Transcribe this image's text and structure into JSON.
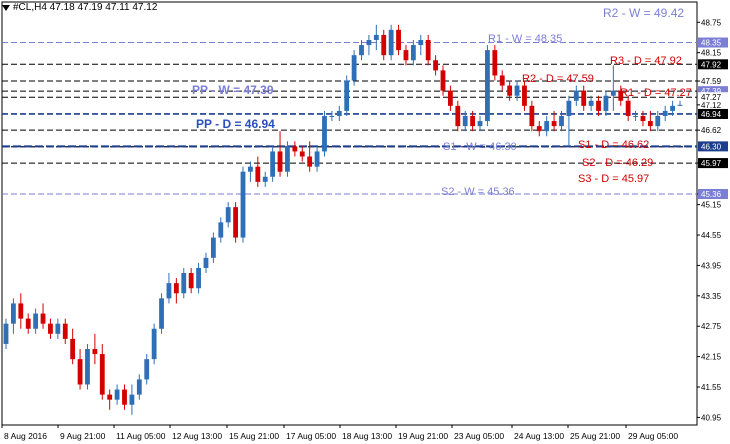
{
  "header": {
    "symbol_line": "#CL,H4  47.18 47.19 47.11 47.12"
  },
  "colors": {
    "bull": "#2f6fb5",
    "bear": "#d40000",
    "weekly_level": "#7b7fd4",
    "daily_pp": "#2b4fbf",
    "daily_r": "#d40000",
    "black_line": "#000000",
    "dark_dash": "#1c3c8c"
  },
  "chart_data": {
    "type": "candlestick",
    "ylim": [
      40.8,
      49.15
    ],
    "y_ticks": [
      "48.75",
      "48.15",
      "47.59",
      "47.12",
      "46.62",
      "45.97",
      "45.36",
      "45.15",
      "44.55",
      "43.95",
      "43.35",
      "42.75",
      "42.15",
      "41.55",
      "40.95"
    ],
    "x_ticks": [
      "8 Aug 2016",
      "9 Aug 21:00",
      "11 Aug 05:00",
      "12 Aug 13:00",
      "15 Aug 21:00",
      "17 Aug 05:00",
      "18 Aug 13:00",
      "19 Aug 21:00",
      "23 Aug 05:00",
      "24 Aug 13:00",
      "25 Aug 21:00",
      "29 Aug 05:00"
    ],
    "levels": [
      {
        "label": "R2 - W = 49.42",
        "value": 49.42,
        "kind": "weekly"
      },
      {
        "label": "R1 - W = 48.35",
        "value": 48.35,
        "kind": "weekly"
      },
      {
        "label": "R3 - D = 47.92",
        "value": 47.92,
        "kind": "daily_r"
      },
      {
        "label": "R2 - D = 47.59",
        "value": 47.59,
        "kind": "daily_r"
      },
      {
        "label": "PP - W = 47.39",
        "value": 47.39,
        "kind": "pp_w"
      },
      {
        "label": "R1 - D = 47.27",
        "value": 47.27,
        "kind": "daily_r"
      },
      {
        "label": "PP - D = 46.94",
        "value": 46.94,
        "kind": "pp_d"
      },
      {
        "label": "S1 - D = 46.62",
        "value": 46.62,
        "kind": "daily_r"
      },
      {
        "label": "S1 - W = 46.30",
        "value": 46.3,
        "kind": "weekly"
      },
      {
        "label": "S2 - D = 46.29",
        "value": 46.29,
        "kind": "daily_r"
      },
      {
        "label": "S3 - D = 45.97",
        "value": 45.97,
        "kind": "daily_r"
      },
      {
        "label": "S2 - W = 45.36",
        "value": 45.36,
        "kind": "weekly"
      }
    ],
    "price_tags": [
      {
        "text": "48.35",
        "value": 48.35,
        "style": "weekly"
      },
      {
        "text": "47.92",
        "value": 47.92,
        "style": "black"
      },
      {
        "text": "47.39",
        "value": 47.39,
        "style": "weekly"
      },
      {
        "text": "47.27",
        "value": 47.27,
        "style": "plain"
      },
      {
        "text": "46.94",
        "value": 46.94,
        "style": "black"
      },
      {
        "text": "46.30",
        "value": 46.3,
        "style": "dark"
      },
      {
        "text": "45.97",
        "value": 45.97,
        "style": "black"
      },
      {
        "text": "45.36",
        "value": 45.36,
        "style": "weekly"
      }
    ],
    "candles": [
      [
        42.4,
        42.9,
        42.3,
        42.8
      ],
      [
        42.8,
        43.3,
        42.6,
        43.2
      ],
      [
        43.2,
        43.4,
        42.7,
        42.9
      ],
      [
        42.9,
        43.0,
        42.6,
        42.7
      ],
      [
        42.7,
        43.1,
        42.6,
        43.0
      ],
      [
        43.0,
        43.2,
        42.7,
        42.8
      ],
      [
        42.8,
        42.9,
        42.5,
        42.6
      ],
      [
        42.6,
        42.9,
        42.5,
        42.8
      ],
      [
        42.8,
        42.9,
        42.4,
        42.5
      ],
      [
        42.5,
        42.7,
        42.0,
        42.1
      ],
      [
        42.1,
        42.3,
        41.5,
        41.6
      ],
      [
        41.6,
        42.4,
        41.5,
        42.3
      ],
      [
        42.3,
        42.6,
        42.0,
        42.2
      ],
      [
        42.2,
        42.4,
        41.3,
        41.4
      ],
      [
        41.4,
        41.5,
        41.1,
        41.3
      ],
      [
        41.3,
        41.6,
        41.2,
        41.5
      ],
      [
        41.5,
        41.6,
        41.1,
        41.2
      ],
      [
        41.2,
        41.6,
        41.0,
        41.4
      ],
      [
        41.4,
        41.8,
        41.3,
        41.7
      ],
      [
        41.7,
        42.2,
        41.6,
        42.1
      ],
      [
        42.1,
        42.8,
        42.0,
        42.7
      ],
      [
        42.7,
        43.4,
        42.6,
        43.3
      ],
      [
        43.3,
        43.8,
        43.2,
        43.6
      ],
      [
        43.6,
        43.7,
        43.2,
        43.4
      ],
      [
        43.4,
        43.9,
        43.3,
        43.8
      ],
      [
        43.8,
        43.9,
        43.4,
        43.5
      ],
      [
        43.5,
        44.0,
        43.4,
        43.9
      ],
      [
        43.9,
        44.2,
        43.8,
        44.1
      ],
      [
        44.1,
        44.6,
        44.0,
        44.5
      ],
      [
        44.5,
        44.9,
        44.4,
        44.8
      ],
      [
        44.8,
        45.2,
        44.7,
        45.1
      ],
      [
        45.1,
        45.2,
        44.4,
        44.5
      ],
      [
        44.5,
        45.9,
        44.4,
        45.8
      ],
      [
        45.8,
        46.0,
        45.6,
        45.9
      ],
      [
        45.9,
        46.1,
        45.5,
        45.6
      ],
      [
        45.6,
        45.8,
        45.5,
        45.7
      ],
      [
        45.7,
        46.3,
        45.6,
        46.2
      ],
      [
        46.2,
        46.6,
        45.7,
        45.8
      ],
      [
        45.8,
        46.4,
        45.7,
        46.3
      ],
      [
        46.3,
        46.4,
        46.1,
        46.2
      ],
      [
        46.2,
        46.3,
        46.0,
        46.1
      ],
      [
        46.1,
        46.4,
        45.8,
        45.9
      ],
      [
        45.9,
        46.3,
        45.8,
        46.2
      ],
      [
        46.2,
        47.0,
        46.1,
        46.9
      ],
      [
        46.9,
        47.0,
        46.8,
        46.9
      ],
      [
        46.9,
        47.1,
        46.8,
        47.0
      ],
      [
        47.0,
        47.7,
        46.9,
        47.6
      ],
      [
        47.6,
        48.2,
        47.5,
        48.1
      ],
      [
        48.1,
        48.4,
        48.0,
        48.3
      ],
      [
        48.3,
        48.5,
        48.1,
        48.4
      ],
      [
        48.4,
        48.7,
        48.2,
        48.5
      ],
      [
        48.5,
        48.6,
        48.0,
        48.1
      ],
      [
        48.1,
        48.7,
        48.0,
        48.6
      ],
      [
        48.6,
        48.7,
        48.1,
        48.2
      ],
      [
        48.2,
        48.3,
        47.9,
        48.0
      ],
      [
        48.0,
        48.4,
        47.9,
        48.3
      ],
      [
        48.3,
        48.5,
        48.1,
        48.4
      ],
      [
        48.4,
        48.5,
        47.9,
        48.0
      ],
      [
        48.0,
        48.1,
        47.7,
        47.8
      ],
      [
        47.8,
        47.9,
        47.3,
        47.4
      ],
      [
        47.4,
        47.5,
        47.0,
        47.1
      ],
      [
        47.1,
        47.2,
        46.6,
        46.7
      ],
      [
        46.7,
        47.0,
        46.6,
        46.9
      ],
      [
        46.9,
        47.0,
        46.6,
        46.7
      ],
      [
        46.7,
        46.9,
        46.6,
        46.8
      ],
      [
        46.8,
        48.3,
        46.7,
        48.2
      ],
      [
        48.2,
        48.3,
        47.6,
        47.7
      ],
      [
        47.7,
        47.8,
        47.4,
        47.5
      ],
      [
        47.5,
        47.6,
        47.2,
        47.3
      ],
      [
        47.3,
        47.6,
        47.2,
        47.5
      ],
      [
        47.5,
        47.6,
        47.0,
        47.1
      ],
      [
        47.1,
        47.2,
        46.6,
        46.7
      ],
      [
        46.7,
        46.8,
        46.5,
        46.6
      ],
      [
        46.6,
        46.9,
        46.5,
        46.8
      ],
      [
        46.8,
        47.0,
        46.6,
        46.7
      ],
      [
        46.7,
        47.0,
        46.6,
        46.9
      ],
      [
        46.9,
        47.3,
        46.3,
        47.2
      ],
      [
        47.2,
        47.5,
        47.1,
        47.4
      ],
      [
        47.4,
        47.5,
        47.0,
        47.1
      ],
      [
        47.1,
        47.3,
        47.0,
        47.2
      ],
      [
        47.2,
        47.3,
        46.9,
        47.0
      ],
      [
        47.0,
        47.4,
        46.9,
        47.3
      ],
      [
        47.3,
        47.9,
        47.0,
        47.4
      ],
      [
        47.4,
        47.5,
        47.1,
        47.2
      ],
      [
        47.2,
        47.3,
        46.8,
        46.9
      ],
      [
        46.9,
        47.0,
        46.8,
        46.9
      ],
      [
        46.9,
        47.0,
        46.7,
        46.8
      ],
      [
        46.8,
        47.0,
        46.6,
        46.7
      ],
      [
        46.7,
        47.0,
        46.6,
        46.9
      ],
      [
        46.9,
        47.1,
        46.8,
        47.0
      ],
      [
        47.0,
        47.2,
        46.9,
        47.1
      ],
      [
        47.1,
        47.2,
        47.1,
        47.12
      ]
    ]
  }
}
